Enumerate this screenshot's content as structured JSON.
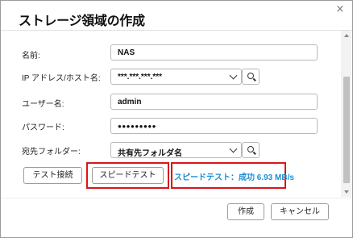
{
  "dialog": {
    "title": "ストレージ領域の作成",
    "close_glyph": "×"
  },
  "form": {
    "name_label": "名前:",
    "name_value": "NAS",
    "ip_label": "IP アドレス/ホスト名:",
    "ip_value": "***.***.***.***",
    "user_label": "ユーザー名:",
    "user_value": "admin",
    "password_label": "パスワード:",
    "password_value": "●●●●●●●●●",
    "dest_label": "宛先フォルダー:",
    "dest_value": "共有先フォルダ名"
  },
  "actions": {
    "test_connection_label": "テスト接続",
    "speed_test_label": "スピードテスト",
    "speed_result": "スピードテスト：成功 6.93 MB/s",
    "create_label": "作成",
    "cancel_label": "キャンセル"
  },
  "colors": {
    "highlight": "#d8161b",
    "result_text": "#1a8fd6"
  },
  "icons": {
    "search": "search-icon",
    "dropdown": "chevron-down-icon",
    "close": "close-icon"
  }
}
